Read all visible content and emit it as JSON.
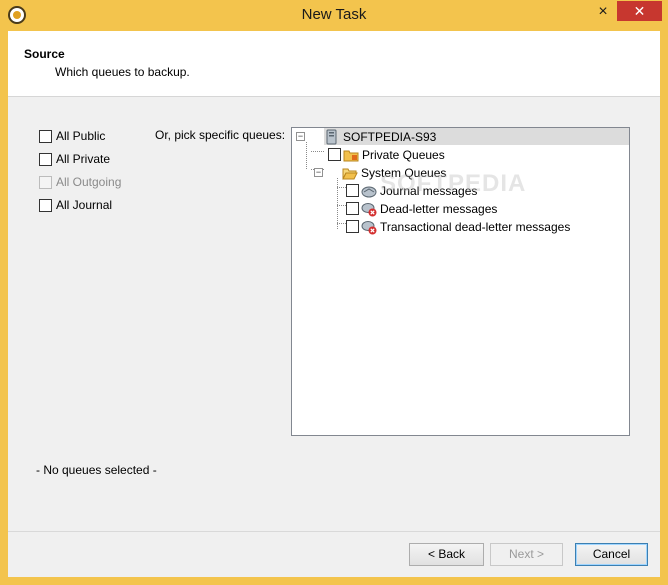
{
  "window": {
    "title": "New Task",
    "close_glyph": "✕",
    "inactive_close_glyph": "×"
  },
  "header": {
    "title": "Source",
    "subtitle": "Which queues to backup."
  },
  "options": [
    {
      "label": "All Public",
      "checked": false,
      "enabled": true
    },
    {
      "label": "All Private",
      "checked": false,
      "enabled": true
    },
    {
      "label": "All Outgoing",
      "checked": false,
      "enabled": false
    },
    {
      "label": "All Journal",
      "checked": false,
      "enabled": true
    }
  ],
  "pick_label": "Or, pick specific queues:",
  "tree": {
    "root": {
      "label": "SOFTPEDIA-S93",
      "icon": "server-icon",
      "expanded": true
    },
    "private": {
      "label": "Private Queues",
      "icon": "folder-icon"
    },
    "system": {
      "label": "System Queues",
      "icon": "open-folder-icon",
      "expanded": true
    },
    "journal": {
      "label": "Journal messages",
      "icon": "queue-icon"
    },
    "deadletter": {
      "label": "Dead-letter messages",
      "icon": "dead-letter-queue-icon"
    },
    "transactional": {
      "label": "Transactional dead-letter messages",
      "icon": "dead-letter-queue-icon"
    }
  },
  "watermark": "SOFTPEDIA",
  "status": "- No queues selected -",
  "buttons": {
    "back": "< Back",
    "next": "Next >",
    "cancel": "Cancel"
  },
  "colors": {
    "frame": "#f3c44d",
    "close": "#c7372f",
    "tree_border": "#828790"
  }
}
